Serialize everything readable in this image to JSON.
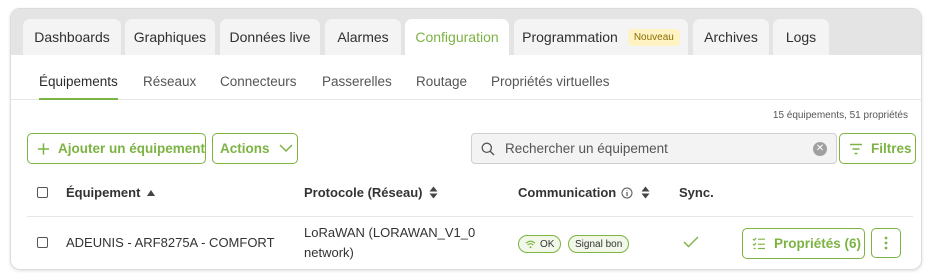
{
  "tabs": [
    {
      "label": "Dashboards"
    },
    {
      "label": "Graphiques"
    },
    {
      "label": "Données live"
    },
    {
      "label": "Alarmes"
    },
    {
      "label": "Configuration",
      "active": true
    },
    {
      "label": "Programmation",
      "badge": "Nouveau"
    },
    {
      "label": "Archives"
    },
    {
      "label": "Logs"
    }
  ],
  "subtabs": [
    "Équipements",
    "Réseaux",
    "Connecteurs",
    "Passerelles",
    "Routage",
    "Propriétés virtuelles"
  ],
  "summary": "15 équipements, 51 propriétés",
  "toolbar": {
    "add_label": "Ajouter un équipement",
    "actions_label": "Actions",
    "search_placeholder": "Rechercher un équipement",
    "filters_label": "Filtres"
  },
  "table": {
    "headers": {
      "equipment": "Équipement",
      "protocol": "Protocole (Réseau)",
      "communication": "Communication",
      "sync": "Sync."
    },
    "rows": [
      {
        "name": "ADEUNIS - ARF8275A - COMFORT",
        "protocol_line1": "LoRaWAN (LORAWAN_V1_0",
        "protocol_line2": "network)",
        "status_ok": "OK",
        "signal": "Signal bon",
        "properties_label": "Propriétés (6)"
      }
    ]
  },
  "colors": {
    "accent": "#7cb342",
    "tabbar_bg": "#e4e4e4",
    "badge_bg": "#fff3c4"
  }
}
